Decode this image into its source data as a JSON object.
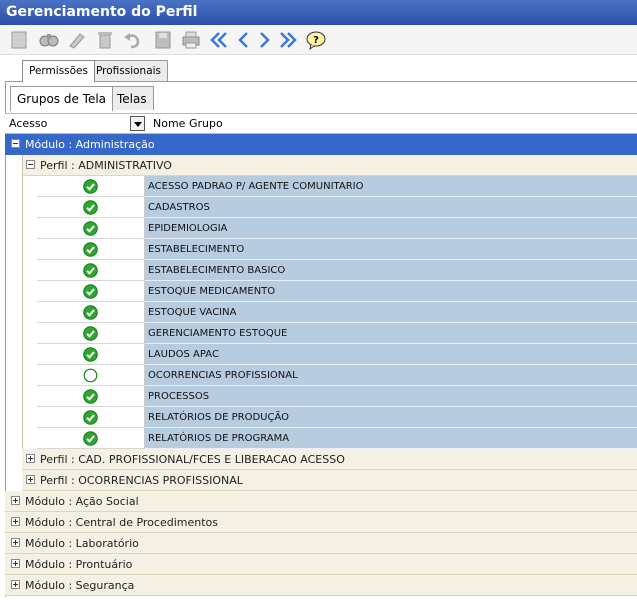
{
  "window": {
    "title": "Gerenciamento do Perfil"
  },
  "toolbar": {
    "buttons": [
      {
        "name": "new-icon"
      },
      {
        "name": "search-icon"
      },
      {
        "name": "edit-icon"
      },
      {
        "name": "delete-icon"
      },
      {
        "name": "undo-icon"
      },
      {
        "name": "save-icon"
      },
      {
        "name": "print-icon"
      },
      {
        "name": "first-icon"
      },
      {
        "name": "previous-icon"
      },
      {
        "name": "next-icon"
      },
      {
        "name": "last-icon"
      },
      {
        "name": "help-icon"
      }
    ]
  },
  "tabs_outer": [
    {
      "label": "Permissões",
      "active": true
    },
    {
      "label": "Profissionais",
      "active": false
    }
  ],
  "tabs_inner": [
    {
      "label": "Grupos de Tela",
      "active": true
    },
    {
      "label": "Telas",
      "active": false
    }
  ],
  "grid": {
    "col_acesso": "Acesso",
    "col_nome": "Nome Grupo",
    "module_open": "Módulo : Administração",
    "perfil_open": "Perfil : ADMINISTRATIVO",
    "rows": [
      {
        "checked": true,
        "name": "ACESSO PADRAO P/ AGENTE COMUNITARIO"
      },
      {
        "checked": true,
        "name": "CADASTROS"
      },
      {
        "checked": true,
        "name": "EPIDEMIOLOGIA"
      },
      {
        "checked": true,
        "name": "ESTABELECIMENTO"
      },
      {
        "checked": true,
        "name": "ESTABELECIMENTO BASICO"
      },
      {
        "checked": true,
        "name": "ESTOQUE MEDICAMENTO"
      },
      {
        "checked": true,
        "name": "ESTOQUE VACINA"
      },
      {
        "checked": true,
        "name": "GERENCIAMENTO ESTOQUE"
      },
      {
        "checked": true,
        "name": "LAUDOS APAC"
      },
      {
        "checked": false,
        "name": "OCORRENCIAS PROFISSIONAL"
      },
      {
        "checked": true,
        "name": "PROCESSOS"
      },
      {
        "checked": true,
        "name": "RELATÓRIOS DE PRODUÇÃO"
      },
      {
        "checked": true,
        "name": "RELATÓRIOS DE PROGRAMA"
      }
    ],
    "perfis_closed": [
      "Perfil : CAD. PROFISSIONAL/FCES E LIBERACAO ACESSO",
      "Perfil : OCORRENCIAS PROFISSIONAL"
    ],
    "modules_closed": [
      "Módulo : Ação Social",
      "Módulo : Central de Procedimentos",
      "Módulo : Laboratório",
      "Módulo : Prontuário",
      "Módulo : Segurança"
    ]
  },
  "colors": {
    "title_bar": "#3560b8",
    "selected_module": "#3568c8",
    "name_cell": "#b8cce0",
    "group_row": "#f4f1e4",
    "check_green": "#2ea52e"
  }
}
